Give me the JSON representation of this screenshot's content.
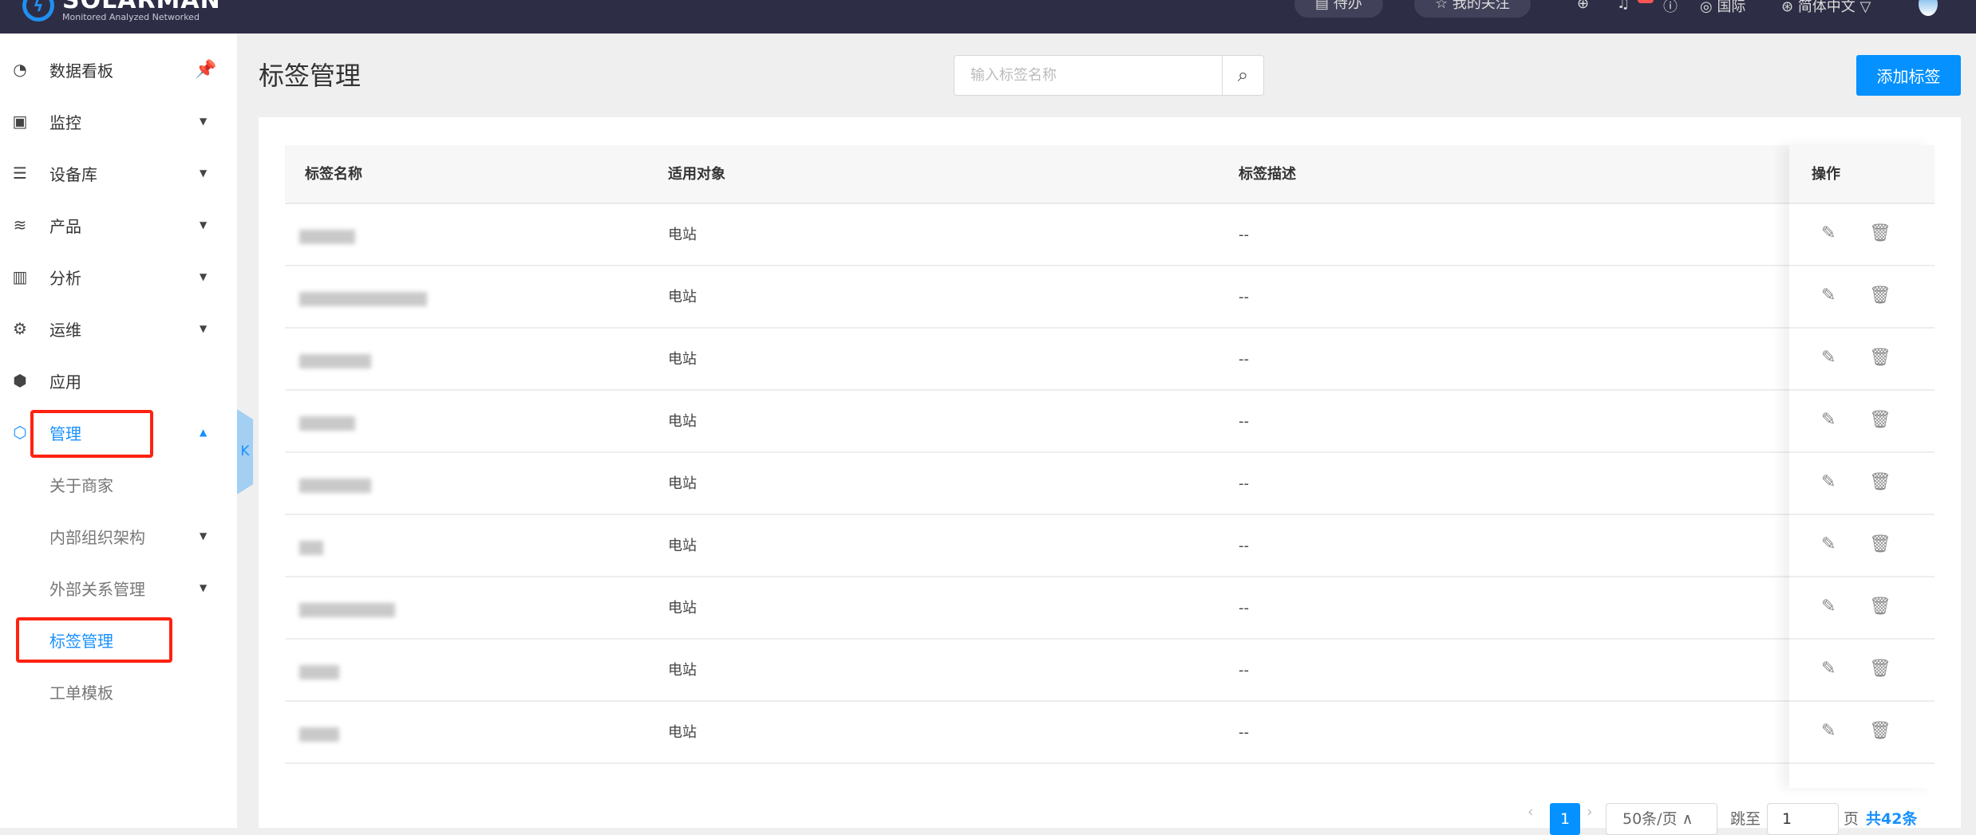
{
  "header": {
    "logo": "SOLARMAN",
    "logo_tagline": "Monitored Analyzed Networked",
    "todo": "待办",
    "favorites": "我的关注",
    "region": "国际",
    "language": "简体中文"
  },
  "sidebar": {
    "items": [
      {
        "label": "数据看板",
        "icon": "dashboard-icon"
      },
      {
        "label": "监控",
        "icon": "monitor-icon"
      },
      {
        "label": "设备库",
        "icon": "device-icon"
      },
      {
        "label": "产品",
        "icon": "layers-icon"
      },
      {
        "label": "分析",
        "icon": "chart-icon"
      },
      {
        "label": "运维",
        "icon": "gear-icon"
      },
      {
        "label": "应用",
        "icon": "cube-icon"
      },
      {
        "label": "管理",
        "icon": "hexagon-icon"
      }
    ],
    "subitems": [
      "关于商家",
      "内部组织架构",
      "外部关系管理",
      "标签管理",
      "工单模板"
    ],
    "collapse": "K"
  },
  "page": {
    "title": "标签管理",
    "search_placeholder": "输入标签名称",
    "add_button": "添加标签"
  },
  "table": {
    "headers": [
      "标签名称",
      "适用对象",
      "标签描述",
      "操作"
    ],
    "rows": [
      {
        "target": "电站",
        "desc": "--"
      },
      {
        "target": "电站",
        "desc": "--"
      },
      {
        "target": "电站",
        "desc": "--"
      },
      {
        "target": "电站",
        "desc": "--"
      },
      {
        "target": "电站",
        "desc": "--"
      },
      {
        "target": "电站",
        "desc": "--"
      },
      {
        "target": "电站",
        "desc": "--"
      },
      {
        "target": "电站",
        "desc": "--"
      },
      {
        "target": "电站",
        "desc": "--"
      }
    ]
  },
  "pagination": {
    "current": "1",
    "page_size": "50条/页",
    "goto_label": "跳至",
    "goto_value": "1",
    "page_unit": "页",
    "total": "共42条"
  },
  "colors": {
    "accent": "#1890ff",
    "topbar": "#2d2d45",
    "highlight": "#ff2211"
  }
}
